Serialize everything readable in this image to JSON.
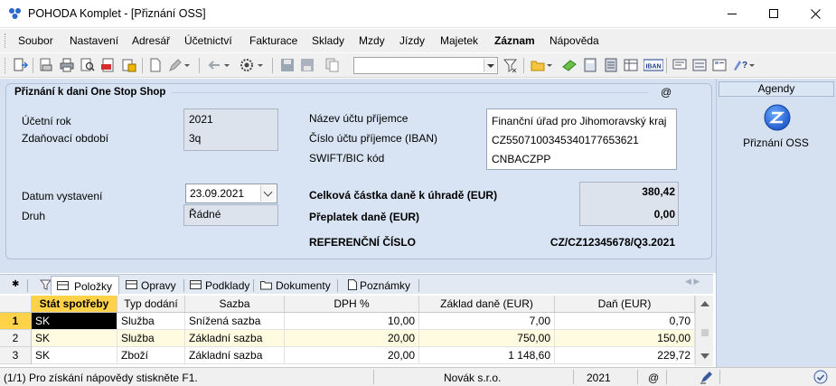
{
  "window": {
    "title": "POHODA Komplet - [Přiznání OSS]",
    "controls": [
      "minimize-icon",
      "maximize-icon",
      "close-icon"
    ]
  },
  "menu": {
    "items": [
      "Soubor",
      "Nastavení",
      "Adresář",
      "Účetnictví",
      "Fakturace",
      "Sklady",
      "Mzdy",
      "Jízdy",
      "Majetek",
      "Záznam",
      "Nápověda"
    ],
    "bold_item": "Záznam"
  },
  "toolbar": {
    "combo_value": "",
    "iban_label": "IBAN"
  },
  "form": {
    "title": "Přiznání k dani One Stop Shop",
    "at_symbol": "@",
    "ucetni_rok_label": "Účetní rok",
    "ucetni_rok_value": "2021",
    "zdanovaci_obdobi_label": "Zdaňovací období",
    "zdanovaci_obdobi_value": "3q",
    "datum_vystaveni_label": "Datum vystavení",
    "datum_vystaveni_value": "23.09.2021",
    "druh_label": "Druh",
    "druh_value": "Řádné",
    "nazev_uctu_label": "Název účtu příjemce",
    "nazev_uctu_value": "Finanční úřad pro Jihomoravský kraj",
    "cislo_uctu_label": "Číslo účtu příjemce (IBAN)",
    "cislo_uctu_value": "CZ5507100345340177653621",
    "swift_label": "SWIFT/BIC kód",
    "swift_value": "CNBACZPP",
    "celkova_castka_label": "Celková částka daně k úhradě (EUR)",
    "celkova_castka_value": "380,42",
    "preplatek_label": "Přeplatek daně (EUR)",
    "preplatek_value": "0,00",
    "referencni_label": "REFERENČNÍ ČÍSLO",
    "referencni_value": "CZ/CZ12345678/Q3.2021"
  },
  "agenda": {
    "header": "Agendy",
    "item_label": "Přiznání OSS"
  },
  "tabs": {
    "star": "✱",
    "items": [
      "Položky",
      "Opravy",
      "Podklady",
      "Dokumenty",
      "Poznámky"
    ],
    "active": "Položky"
  },
  "table": {
    "columns": [
      "Stát spotřeby",
      "Typ dodání",
      "Sazba",
      "DPH %",
      "Základ daně (EUR)",
      "Daň (EUR)"
    ],
    "rows": [
      {
        "num": "1",
        "stat": "SK",
        "typ": "Služba",
        "sazba": "Snížená sazba",
        "dph": "10,00",
        "zaklad": "7,00",
        "dan": "0,70"
      },
      {
        "num": "2",
        "stat": "SK",
        "typ": "Služba",
        "sazba": "Základní sazba",
        "dph": "20,00",
        "zaklad": "750,00",
        "dan": "150,00"
      },
      {
        "num": "3",
        "stat": "SK",
        "typ": "Zboží",
        "sazba": "Základní sazba",
        "dph": "20,00",
        "zaklad": "1 148,60",
        "dan": "229,72"
      }
    ]
  },
  "status": {
    "help": "(1/1) Pro získání nápovědy stiskněte F1.",
    "company": "Novák s.r.o.",
    "year": "2021",
    "at": "@"
  },
  "colors": {
    "panel_bg": "#d5e1f0",
    "selected_header": "#ffd24a",
    "highlight_row": "#fffbe0"
  }
}
